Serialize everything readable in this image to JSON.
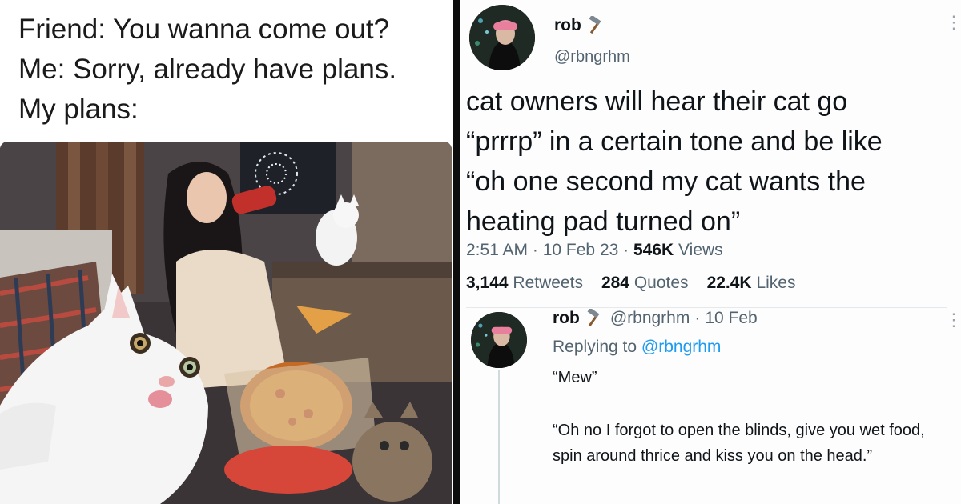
{
  "meme": {
    "caption_lines": [
      "Friend: You wanna come out?",
      "Me: Sorry, already have plans.",
      "My plans:"
    ],
    "photo_description_icon": "photo-icon"
  },
  "tweet": {
    "display_name": "rob",
    "handle": "@rbngrhm",
    "text_lines": [
      "cat owners will hear their cat go",
      "“prrrp” in a certain tone and be like",
      "“oh one second my cat wants the",
      "heating pad turned on”"
    ],
    "time": "2:51 AM",
    "date": "10 Feb 23",
    "views_count": "546K",
    "views_label": "Views",
    "retweets_count": "3,144",
    "retweets_label": "Retweets",
    "quotes_count": "284",
    "quotes_label": "Quotes",
    "likes_count": "22.4K",
    "likes_label": "Likes"
  },
  "reply": {
    "display_name": "rob",
    "handle": "@rbngrhm",
    "date": "10 Feb",
    "replying_prefix": "Replying to",
    "replying_to": "@rbngrhm",
    "line1": "“Mew”",
    "line2": "“Oh no I forgot to open the blinds, give you wet food, spin around thrice and kiss you on the head.”"
  },
  "colors": {
    "link_blue": "#1d9bf0",
    "secondary_text": "#536471",
    "primary_text": "#0f1419",
    "divider": "#0d0d0d"
  }
}
